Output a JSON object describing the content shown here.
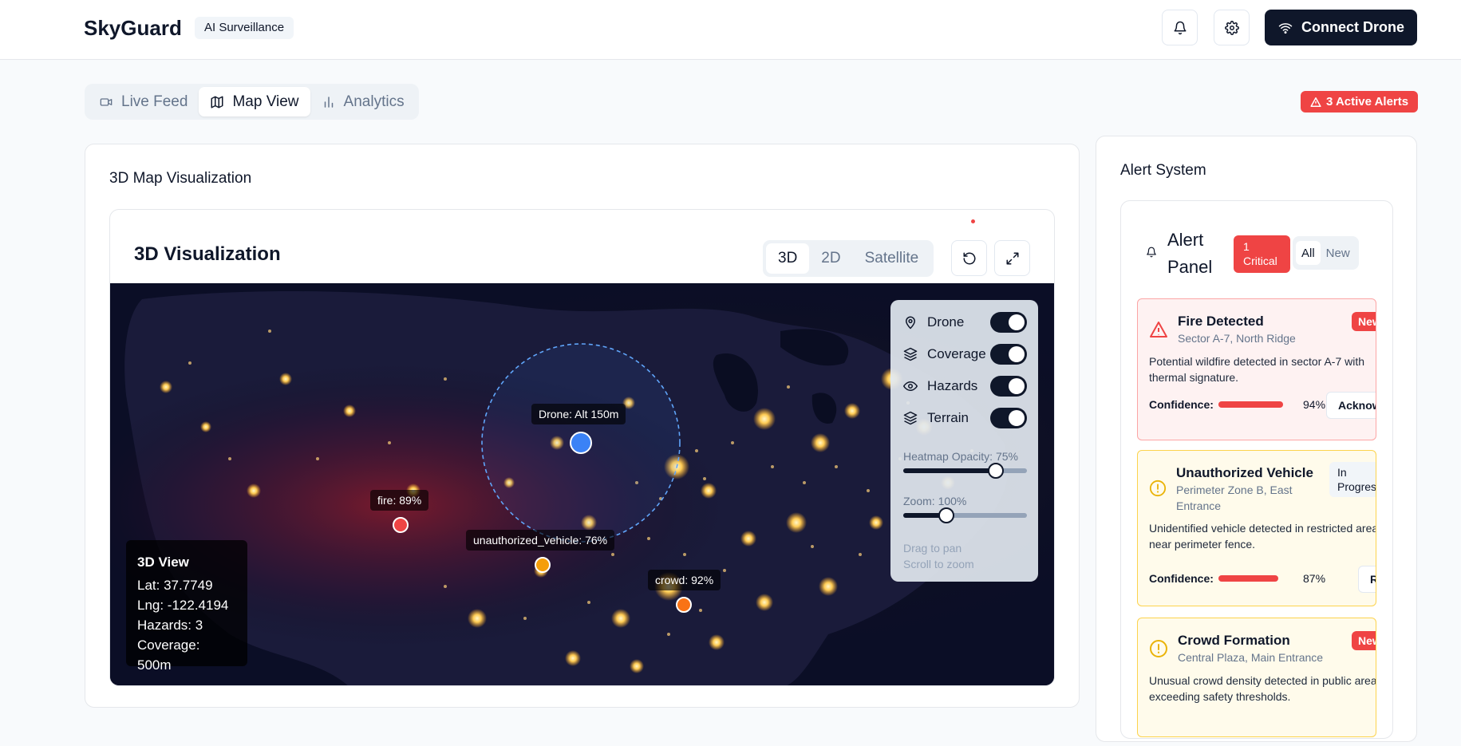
{
  "header": {
    "brand": "SkyGuard",
    "badge": "AI Surveillance",
    "connect_label": "Connect Drone",
    "icons": [
      "bell-icon",
      "settings-icon",
      "wifi-icon"
    ]
  },
  "tabs": [
    {
      "label": "Live Feed",
      "icon": "video-icon",
      "active": false
    },
    {
      "label": "Map View",
      "icon": "map-icon",
      "active": true
    },
    {
      "label": "Analytics",
      "icon": "bar-chart-icon",
      "active": false
    }
  ],
  "active_alerts": "3 Active Alerts",
  "map_card": {
    "title": "3D Map Visualization",
    "viz_title": "3D Visualization",
    "modes": [
      {
        "label": "3D",
        "active": true
      },
      {
        "label": "2D",
        "active": false
      },
      {
        "label": "Satellite",
        "active": false
      }
    ],
    "layers": [
      {
        "label": "Drone",
        "icon": "pin-icon",
        "on": true
      },
      {
        "label": "Coverage",
        "icon": "layers-icon",
        "on": true
      },
      {
        "label": "Hazards",
        "icon": "eye-icon",
        "on": true
      },
      {
        "label": "Terrain",
        "icon": "layers-icon",
        "on": true
      }
    ],
    "heatmap_label": "Heatmap Opacity: 75%",
    "heatmap_value": 0.75,
    "zoom_label": "Zoom: 100%",
    "zoom_value": 0.35,
    "hint_pan": "Drag to pan",
    "hint_zoom": "Scroll to zoom",
    "info": {
      "title": "3D View",
      "lat": "Lat: 37.7749",
      "lng": "Lng: -122.4194",
      "hazards": "Hazards: 3",
      "coverage": "Coverage: 500m"
    },
    "markers": {
      "drone": "Drone: Alt 150m",
      "fire": "fire: 89%",
      "vehicle": "unauthorized_vehicle: 76%",
      "crowd": "crowd: 92%"
    },
    "colors": {
      "drone": "#3b82f6",
      "fire": "#ef4444",
      "vehicle": "#f59e0b",
      "crowd": "#f97316"
    }
  },
  "alert_card": {
    "title": "Alert System",
    "panel_title_1": "Alert",
    "panel_title_2": "Panel",
    "critical_1": "1",
    "critical_2": "Critical",
    "filters": [
      {
        "label": "All",
        "active": true
      },
      {
        "label": "New",
        "active": false
      }
    ],
    "alerts": [
      {
        "title": "Fire Detected",
        "location": "Sector A-7, North Ridge",
        "status": "New",
        "description": "Potential wildfire detected in sector A-7 with thermal signature.",
        "confidence_label": "Confidence:",
        "confidence": "94%",
        "confidence_value": 0.94,
        "action": "Acknowledge"
      },
      {
        "title": "Unauthorized Vehicle",
        "location_1": "Perimeter Zone B, East",
        "location_2": "Entrance",
        "status_1": "In",
        "status_2": "Progress",
        "description": "Unidentified vehicle detected in restricted area near perimeter fence.",
        "confidence_label": "Confidence:",
        "confidence": "87%",
        "confidence_value": 0.87,
        "action": "Resolve"
      },
      {
        "title": "Crowd Formation",
        "location": "Central Plaza, Main Entrance",
        "status": "New",
        "description": "Unusual crowd density detected in public area exceeding safety thresholds."
      }
    ]
  }
}
